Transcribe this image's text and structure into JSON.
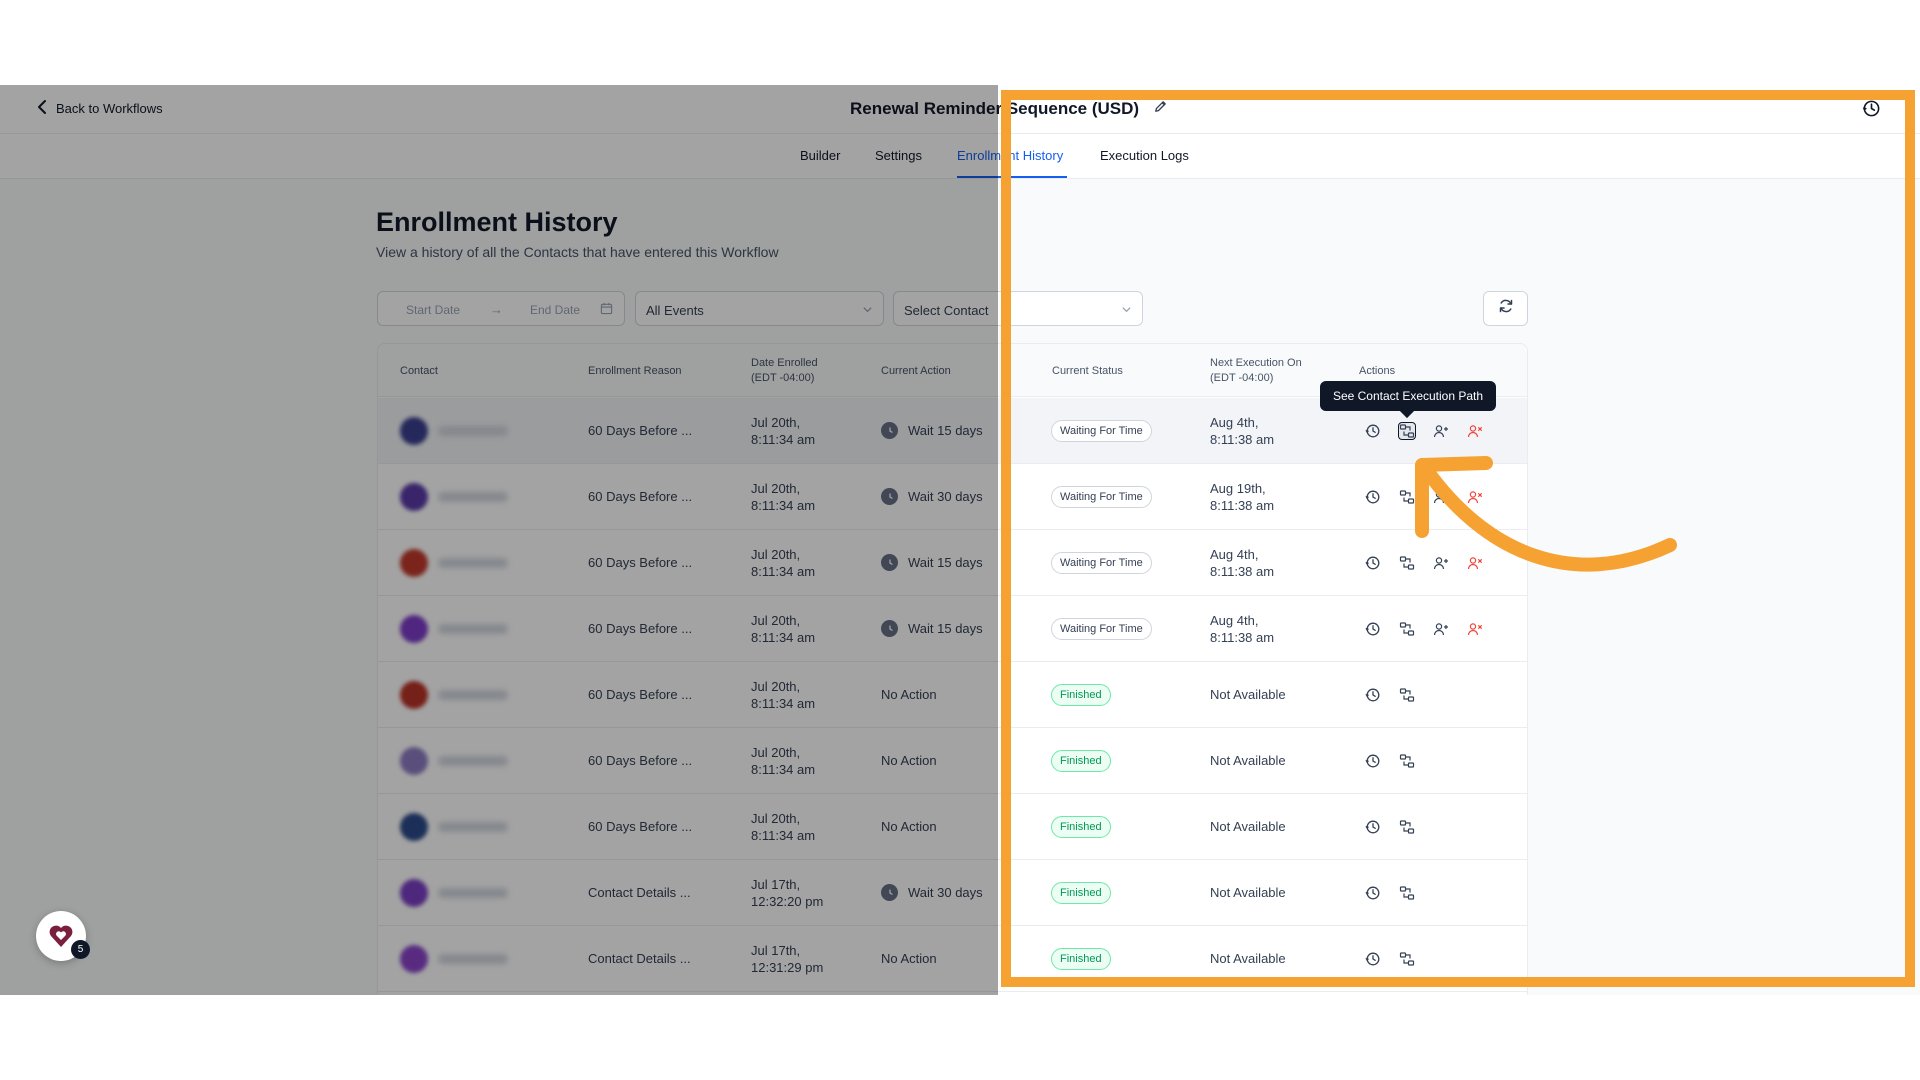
{
  "header": {
    "back_label": "Back to Workflows",
    "workflow_title": "Renewal Reminder Sequence (USD)"
  },
  "tabs": [
    {
      "label": "Builder"
    },
    {
      "label": "Settings"
    },
    {
      "label": "Enrollment History",
      "active": true
    },
    {
      "label": "Execution Logs"
    }
  ],
  "page": {
    "title": "Enrollment History",
    "subtitle": "View a history of all the Contacts that have entered this Workflow"
  },
  "filters": {
    "start_date_placeholder": "Start Date",
    "end_date_placeholder": "End Date",
    "events_value": "All Events",
    "contact_placeholder": "Select Contact"
  },
  "table": {
    "columns": {
      "contact": "Contact",
      "reason": "Enrollment Reason",
      "date_enrolled": "Date Enrolled",
      "date_tz": "(EDT -04:00)",
      "current_action": "Current Action",
      "current_status": "Current Status",
      "next_execution": "Next Execution On",
      "next_tz": "(EDT -04:00)",
      "actions": "Actions"
    },
    "rows": [
      {
        "reason": "60 Days Before ...",
        "date1": "Jul 20th,",
        "date2": "8:11:34 am",
        "action": "Wait 15 days",
        "status": "Waiting For Time",
        "next1": "Aug 4th,",
        "next2": "8:11:38 am",
        "avatar_color": "#3b3f8f"
      },
      {
        "reason": "60 Days Before ...",
        "date1": "Jul 20th,",
        "date2": "8:11:34 am",
        "action": "Wait 30 days",
        "status": "Waiting For Time",
        "next1": "Aug 19th,",
        "next2": "8:11:38 am",
        "avatar_color": "#5b3aa8"
      },
      {
        "reason": "60 Days Before ...",
        "date1": "Jul 20th,",
        "date2": "8:11:34 am",
        "action": "Wait 15 days",
        "status": "Waiting For Time",
        "next1": "Aug 4th,",
        "next2": "8:11:38 am",
        "avatar_color": "#c0392b"
      },
      {
        "reason": "60 Days Before ...",
        "date1": "Jul 20th,",
        "date2": "8:11:34 am",
        "action": "Wait 15 days",
        "status": "Waiting For Time",
        "next1": "Aug 4th,",
        "next2": "8:11:38 am",
        "avatar_color": "#7d3cc8"
      },
      {
        "reason": "60 Days Before ...",
        "date1": "Jul 20th,",
        "date2": "8:11:34 am",
        "action": "No Action",
        "status": "Finished",
        "next1": "Not Available",
        "next2": "",
        "avatar_color": "#b83227"
      },
      {
        "reason": "60 Days Before ...",
        "date1": "Jul 20th,",
        "date2": "8:11:34 am",
        "action": "No Action",
        "status": "Finished",
        "next1": "Not Available",
        "next2": "",
        "avatar_color": "#8e7cc3"
      },
      {
        "reason": "60 Days Before ...",
        "date1": "Jul 20th,",
        "date2": "8:11:34 am",
        "action": "No Action",
        "status": "Finished",
        "next1": "Not Available",
        "next2": "",
        "avatar_color": "#2c4a8a"
      },
      {
        "reason": "Contact Details ...",
        "date1": "Jul 17th,",
        "date2": "12:32:20 pm",
        "action": "Wait 30 days",
        "status": "Finished",
        "next1": "Not Available",
        "next2": "",
        "avatar_color": "#7b3fc4"
      },
      {
        "reason": "Contact Details ...",
        "date1": "Jul 17th,",
        "date2": "12:31:29 pm",
        "action": "No Action",
        "status": "Finished",
        "next1": "Not Available",
        "next2": "",
        "avatar_color": "#8a44c9"
      }
    ]
  },
  "tooltip": {
    "text": "See Contact Execution Path"
  },
  "notifications": {
    "count": "5"
  },
  "colors": {
    "accent": "#155eef",
    "highlight": "#f6a233",
    "danger": "#f04438",
    "success": "#039855"
  },
  "icons": {
    "history": "history-icon",
    "execution_path": "execution-path-icon",
    "add_user": "add-user-icon",
    "remove_user": "remove-user-icon"
  }
}
